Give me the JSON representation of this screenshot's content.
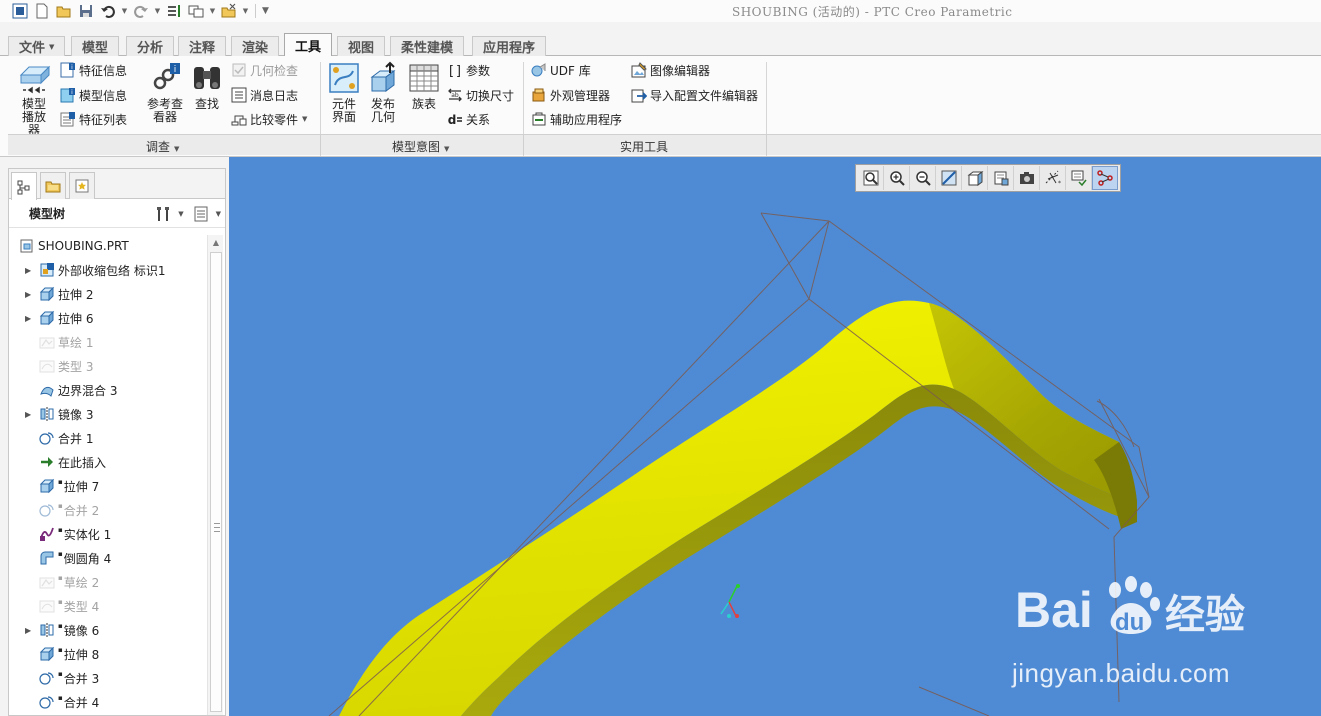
{
  "window": {
    "title": "SHOUBING (活动的) - PTC Creo Parametric"
  },
  "tabs": [
    {
      "label": "文件",
      "has_dropdown": true
    },
    {
      "label": "模型"
    },
    {
      "label": "分析"
    },
    {
      "label": "注释"
    },
    {
      "label": "渲染"
    },
    {
      "label": "工具",
      "active": true
    },
    {
      "label": "视图"
    },
    {
      "label": "柔性建模"
    },
    {
      "label": "应用程序"
    }
  ],
  "ribbon": {
    "groups": {
      "investigate": "调查",
      "model_intent": "模型意图",
      "utilities": "实用工具"
    },
    "investigate": {
      "model_player": "模型播放器",
      "feature_info": "特征信息",
      "model_info": "模型信息",
      "feature_list": "特征列表",
      "reference_viewer": "参考查看器",
      "find": "查找",
      "geometry_check": "几何检查",
      "message_log": "消息日志",
      "compare_part": "比较零件"
    },
    "model_intent": {
      "component_interface": "元件界面",
      "publish_geometry": "发布几何",
      "family_table": "族表",
      "parameters": "参数",
      "switch_dimensions": "切换尺寸",
      "relations": "关系"
    },
    "utilities": {
      "udf_library": "UDF 库",
      "appearance_manager": "外观管理器",
      "auxiliary_app": "辅助应用程序",
      "image_editor": "图像编辑器",
      "import_config_editor": "导入配置文件编辑器"
    }
  },
  "model_tree": {
    "title": "模型树",
    "root": "SHOUBING.PRT",
    "items": [
      {
        "label": "外部收缩包络 标识1",
        "icon": "shrinkwrap-icon",
        "expandable": true,
        "dim": false,
        "suppressed_mark": false
      },
      {
        "label": "拉伸 2",
        "icon": "extrude-icon",
        "expandable": true,
        "dim": false,
        "suppressed_mark": false
      },
      {
        "label": "拉伸 6",
        "icon": "extrude-icon",
        "expandable": true,
        "dim": false,
        "suppressed_mark": false
      },
      {
        "label": "草绘 1",
        "icon": "sketch-icon",
        "expandable": false,
        "dim": true,
        "suppressed_mark": false
      },
      {
        "label": "类型 3",
        "icon": "style-icon",
        "expandable": false,
        "dim": true,
        "suppressed_mark": false
      },
      {
        "label": "边界混合 3",
        "icon": "boundary-blend-icon",
        "expandable": false,
        "dim": false,
        "suppressed_mark": false
      },
      {
        "label": "镜像 3",
        "icon": "mirror-icon",
        "expandable": true,
        "dim": false,
        "suppressed_mark": false
      },
      {
        "label": "合并 1",
        "icon": "merge-icon",
        "expandable": false,
        "dim": false,
        "suppressed_mark": false
      },
      {
        "label": "在此插入",
        "icon": "insert-here-icon",
        "expandable": false,
        "dim": false,
        "suppressed_mark": false
      },
      {
        "label": "拉伸 7",
        "icon": "extrude-icon",
        "expandable": false,
        "dim": false,
        "suppressed_mark": true
      },
      {
        "label": "合并 2",
        "icon": "merge-icon",
        "expandable": false,
        "dim": true,
        "suppressed_mark": true
      },
      {
        "label": "实体化 1",
        "icon": "solidify-icon",
        "expandable": false,
        "dim": false,
        "suppressed_mark": true
      },
      {
        "label": "倒圆角 4",
        "icon": "round-icon",
        "expandable": false,
        "dim": false,
        "suppressed_mark": true
      },
      {
        "label": "草绘 2",
        "icon": "sketch-icon",
        "expandable": false,
        "dim": true,
        "suppressed_mark": true
      },
      {
        "label": "类型 4",
        "icon": "style-icon",
        "expandable": false,
        "dim": true,
        "suppressed_mark": true
      },
      {
        "label": "镜像 6",
        "icon": "mirror-icon",
        "expandable": true,
        "dim": false,
        "suppressed_mark": true
      },
      {
        "label": "拉伸 8",
        "icon": "extrude-icon",
        "expandable": false,
        "dim": false,
        "suppressed_mark": true
      },
      {
        "label": "合并 3",
        "icon": "merge-icon",
        "expandable": false,
        "dim": false,
        "suppressed_mark": true
      },
      {
        "label": "合并 4",
        "icon": "merge-icon",
        "expandable": false,
        "dim": false,
        "suppressed_mark": true
      }
    ]
  },
  "viewport": {
    "background": "#4f8bd4",
    "model_color": "#e6e600",
    "toolbar_icons": [
      "refit-icon",
      "zoom-in-icon",
      "zoom-out-icon",
      "repaint-icon",
      "display-style-icon",
      "saved-orientations-icon",
      "view-manager-icon",
      "datum-display-icon",
      "spin-center-icon",
      "annotation-display-icon"
    ]
  },
  "watermark": {
    "brand": "Bai du 经验",
    "url": "jingyan.baidu.com"
  }
}
